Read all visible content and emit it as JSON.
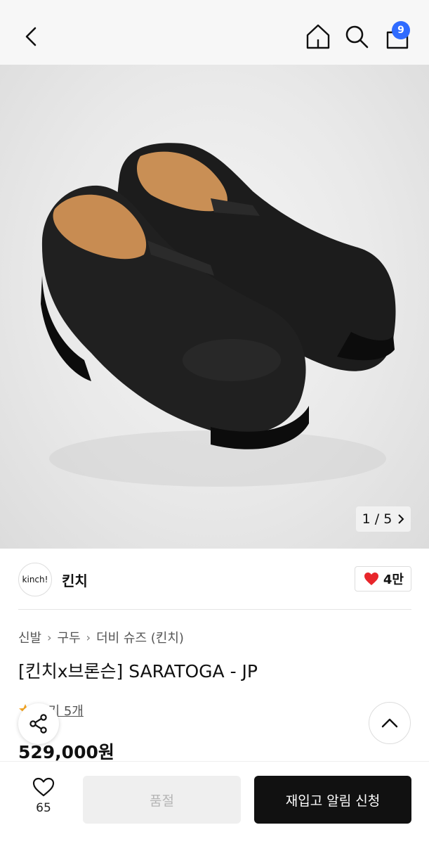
{
  "header": {
    "cart_count": "9"
  },
  "gallery": {
    "pager": "1 / 5"
  },
  "brand": {
    "logo_text": "kinch!",
    "name": "킨치",
    "likes": "4만"
  },
  "breadcrumb": [
    "신발",
    "구두",
    "더비 슈즈 (킨치)"
  ],
  "product": {
    "title": "[킨치x브론슨] SARATOGA - JP",
    "review_link": "후기 5개",
    "price": "529,000원"
  },
  "bottom_bar": {
    "wish_count": "65",
    "soldout_label": "품절",
    "restock_label": "재입고 알림 신청"
  },
  "colors": {
    "badge": "#2f6bff",
    "heart": "#e8262b",
    "cta": "#111111"
  }
}
